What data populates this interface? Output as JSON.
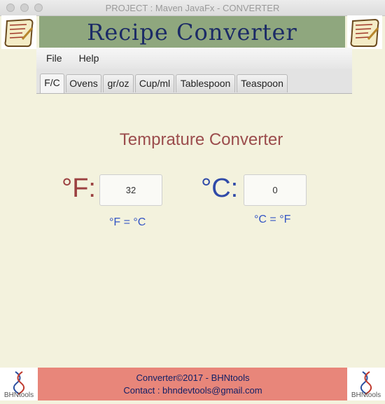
{
  "window": {
    "title": "PROJECT : Maven JavaFx - CONVERTER"
  },
  "banner": {
    "title": "Recipe Converter"
  },
  "menu": {
    "items": [
      "File",
      "Help"
    ]
  },
  "tabs": [
    {
      "label": "F/C",
      "active": true
    },
    {
      "label": "Ovens"
    },
    {
      "label": "gr/oz"
    },
    {
      "label": "Cup/ml"
    },
    {
      "label": "Tablespoon"
    },
    {
      "label": "Teaspoon"
    }
  ],
  "converter": {
    "title": "Temprature Converter",
    "fahrenheit": {
      "label": "°F:",
      "value": "32",
      "formula": "°F = °C",
      "color": "#9b4040"
    },
    "celsius": {
      "label": "°C:",
      "value": "0",
      "formula": "°C = °F",
      "color": "#2f4aa8"
    }
  },
  "footer": {
    "line1": "Converter©2017 - BHNtools",
    "line2": "Contact : bhndevtools@gmail.com",
    "logo_text": "BHNtools"
  },
  "icons": {
    "banner": "recipe-scroll-icon",
    "footer": "dna-logo-icon"
  }
}
